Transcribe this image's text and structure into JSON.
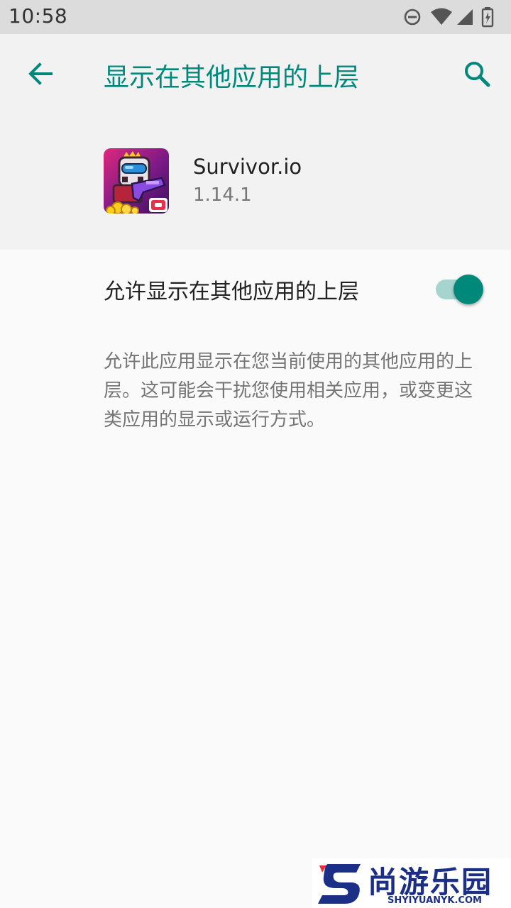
{
  "status_bar": {
    "time": "10:58",
    "icons": [
      "dnd-icon",
      "wifi-icon",
      "signal-icon",
      "battery-icon"
    ]
  },
  "app_bar": {
    "title": "显示在其他应用的上层",
    "back_icon": "arrow-back-icon",
    "search_icon": "search-icon",
    "accent": "#00897b"
  },
  "app_info": {
    "name": "Survivor.io",
    "version": "1.14.1"
  },
  "permission": {
    "label": "允许显示在其他应用的上层",
    "enabled": true,
    "description": "允许此应用显示在您当前使用的其他应用的上层。这可能会干扰您使用相关应用，或变更这类应用的显示或运行方式。"
  },
  "watermark": {
    "brand": "尚游乐园",
    "domain": "SHYIYUANYK.COM"
  }
}
